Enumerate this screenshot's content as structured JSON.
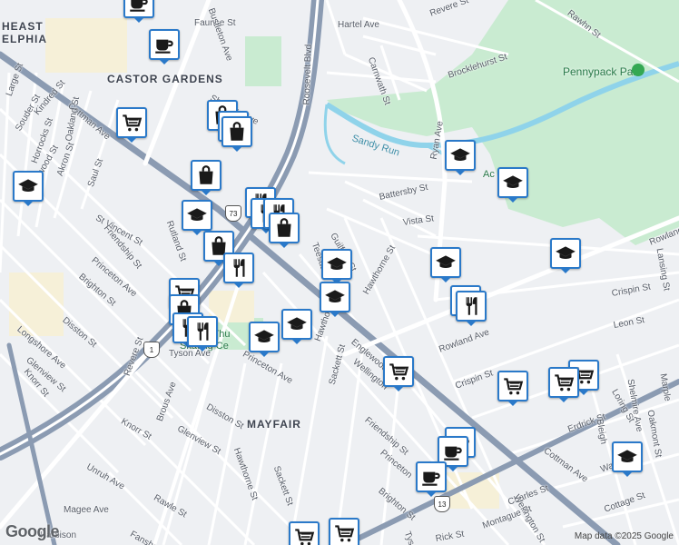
{
  "area_labels": {
    "northeast": "HEAST\nELPHIA",
    "castor": "CASTOR GARDENS",
    "mayfair": "MAYFAIR"
  },
  "park_labels": {
    "pennypack": "Pennypack Park",
    "rolling": "Rolling Thu\nSkating Ce"
  },
  "water_labels": {
    "sandy_run": "Sandy Run"
  },
  "school_label": "Ac    School",
  "streets": [
    "Faunce St",
    "Hartel Ave",
    "Revere St",
    "Rawhn St",
    "Bustleton Ave",
    "Carnwath St",
    "Brocklehurst St",
    "Shelmire Ave",
    "Roosevelt Blvd",
    "Ryan Ave",
    "Battersby St",
    "Vista St",
    "Guilford St",
    "Hawthorne St",
    "Rowland Ave",
    "Rowland",
    "Crispin St",
    "Leon St",
    "Lansing St",
    "Cottman Ave",
    "Cottman Ave",
    "Tyson Ave",
    "Brous Ave",
    "Princeton Ave",
    "Disston St",
    "Glenview St",
    "Knorr St",
    "Revere St",
    "Unruh Ave",
    "Magee Ave",
    "Fanshawe St",
    "Rawle St",
    "Hawthorne St",
    "Sackett St",
    "Friendship St",
    "Princeton",
    "Brighton St",
    "Wellington",
    "Englewood",
    "Charles St",
    "Wellington St",
    "Montague St",
    "Erdrick St",
    "Walker St",
    "Cottage St",
    "Loring St",
    "Bleigh",
    "Shelmire Ave",
    "Oakmont St",
    "Marple",
    "St Vincent St",
    "Friendship St",
    "Princeton Ave",
    "Brighton St",
    "Disston St",
    "Longshore Ave",
    "Glenview St",
    "Knorr St",
    "Akron St",
    "Eastwood St",
    "Saul St",
    "Oakland St",
    "Horrocks St",
    "Souder St",
    "Kindred St",
    "Large St",
    "Rutland St",
    "Teesdale",
    "Harbison",
    "Hawthorne St",
    "Sackett St",
    "Crispin St",
    "Tysc",
    "Rick St"
  ],
  "shields": {
    "us73a": "73",
    "us1": "1",
    "us13": "13"
  },
  "markers": [
    {
      "type": "cafe",
      "name": "cafe-marker-1"
    },
    {
      "type": "cafe",
      "name": "cafe-marker-2"
    },
    {
      "type": "grocery",
      "name": "grocery-marker-1"
    },
    {
      "type": "shopping",
      "name": "shopping-marker-1"
    },
    {
      "type": "shopping",
      "name": "shopping-marker-2"
    }
  ],
  "attribution": "Map data ©2025 Google",
  "logo": "Google",
  "colors": {
    "marker_border": "#2a79c9",
    "park": "#c9ebd1",
    "water": "#8fd3ea",
    "highway": "#8b9bb2",
    "road": "#ffffff"
  }
}
